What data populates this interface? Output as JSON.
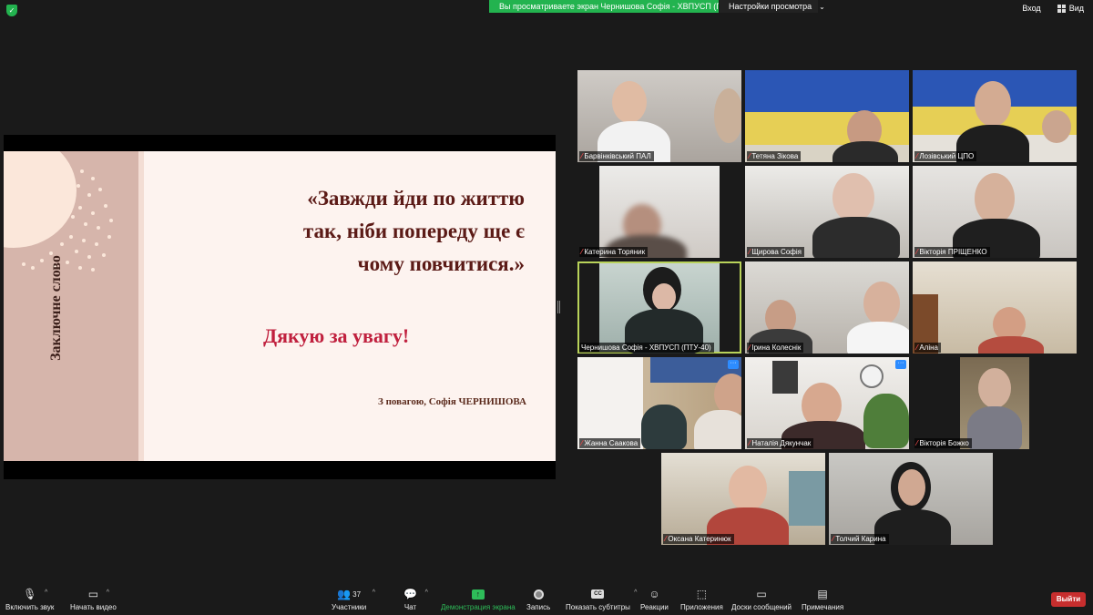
{
  "topbar": {
    "share_banner": "Вы просматриваете экран Чернишова Софія - ХВПУСП (ПТУ-...",
    "view_options": "Настройки просмотра",
    "exit_fullscreen": "Вход",
    "view": "Вид"
  },
  "slide": {
    "side_title": "Заключне слово",
    "quote_lines": [
      "«Завжди йди по життю",
      "так, ніби попереду ще є",
      "чому повчитися.»"
    ],
    "thanks": "Дякую за увагу!",
    "signature": "З повагою, Софія ЧЕРНИШОВА"
  },
  "participants": [
    {
      "name": "Барвінківський ПАЛ"
    },
    {
      "name": "Тетяна Зікова"
    },
    {
      "name": "Лозівський ЦПО"
    },
    {
      "name": "Катерина Торяник"
    },
    {
      "name": "Щирова Софія"
    },
    {
      "name": "Вікторія ПРІЩЕНКО"
    },
    {
      "name": "Чернишова Софія - ХВПУСП (ПТУ-40)"
    },
    {
      "name": "Ірина Колеснік"
    },
    {
      "name": "Аліна"
    },
    {
      "name": "Жанна Саакова"
    },
    {
      "name": "Наталія Дякунчак"
    },
    {
      "name": "Вікторія Божко"
    },
    {
      "name": "Оксана Катеринюк"
    },
    {
      "name": "Толчий Карина"
    }
  ],
  "toolbar": {
    "unmute": "Включить звук",
    "start_video": "Начать видео",
    "participants": "Участники",
    "participants_count": "37",
    "chat": "Чат",
    "share_screen": "Демонстрация экрана",
    "record": "Запись",
    "captions": "Показать субтитры",
    "captions_icon": "CC",
    "reactions": "Реакции",
    "apps": "Приложения",
    "whiteboards": "Доски сообщений",
    "notes": "Примечания",
    "leave": "Выйти"
  },
  "colors": {
    "share_green": "#23b34f",
    "leave_red": "#c72e2e",
    "active_speaker": "#b9d35a",
    "quote_text": "#5b1a16",
    "thanks_text": "#c0203e"
  }
}
